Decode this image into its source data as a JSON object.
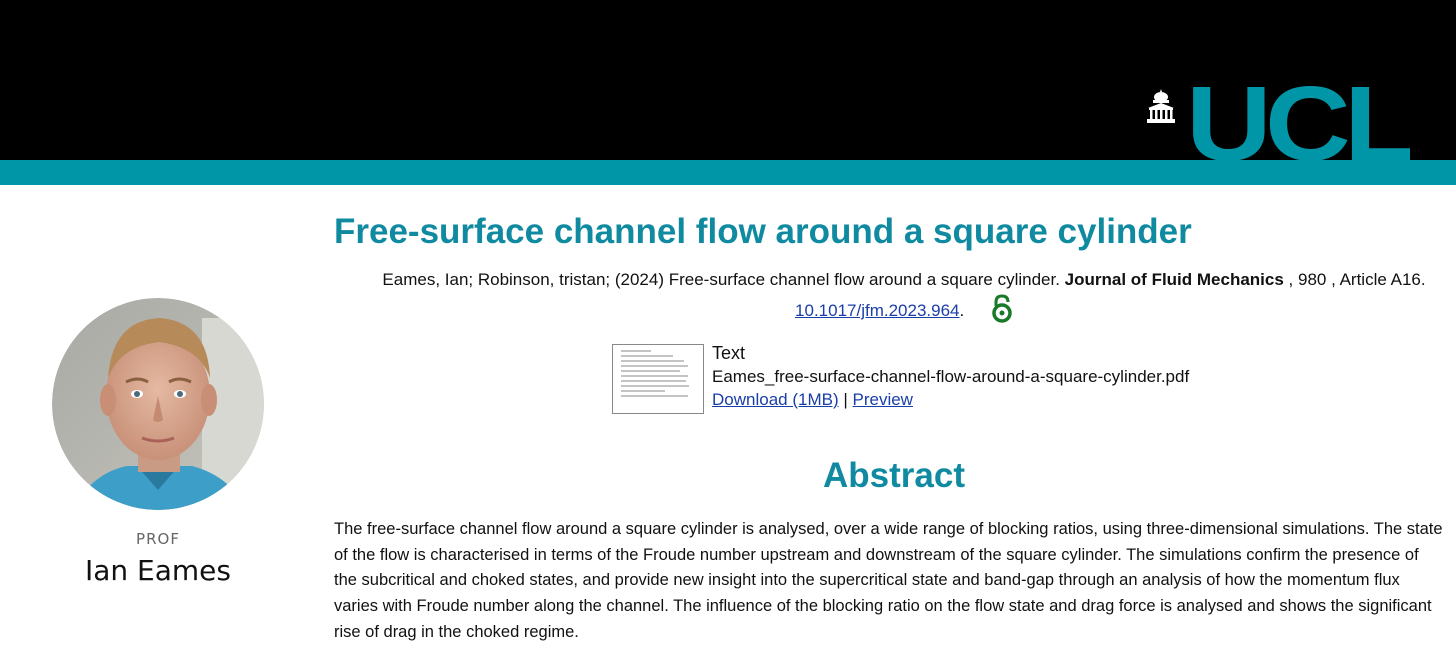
{
  "header": {
    "logo_text": "UCL",
    "colors": {
      "background": "#000000",
      "accent": "#0096a8"
    }
  },
  "profile": {
    "title": "PROF",
    "name": "Ian Eames"
  },
  "main": {
    "title": "Free-surface channel flow around a square cylinder",
    "citation": {
      "authors_year_title": "Eames, Ian; Robinson, tristan; (2024) Free-surface channel flow around a square cylinder.",
      "journal": "Journal of Fluid Mechanics",
      "volume_article": ", 980 , Article A16.",
      "doi": "10.1017/jfm.2023.964",
      "doi_suffix": ".",
      "open_access_icon": "open-access-icon"
    },
    "document": {
      "type": "Text",
      "filename": "Eames_free-surface-channel-flow-around-a-square-cylinder.pdf",
      "download_label": "Download (1MB)",
      "separator": "|",
      "preview_label": "Preview"
    },
    "abstract_heading": "Abstract",
    "abstract_text": "The free-surface channel flow around a square cylinder is analysed, over a wide range of blocking ratios, using three-dimensional simulations. The state of the flow is characterised in terms of the Froude number upstream and downstream of the square cylinder. The simulations confirm the presence of the subcritical and choked states, and provide new insight into the supercritical state and band-gap through an analysis of how the momentum flux varies with Froude number along the channel. The influence of the blocking ratio on the flow state and drag force is analysed and shows the significant rise of drag in the choked regime."
  }
}
